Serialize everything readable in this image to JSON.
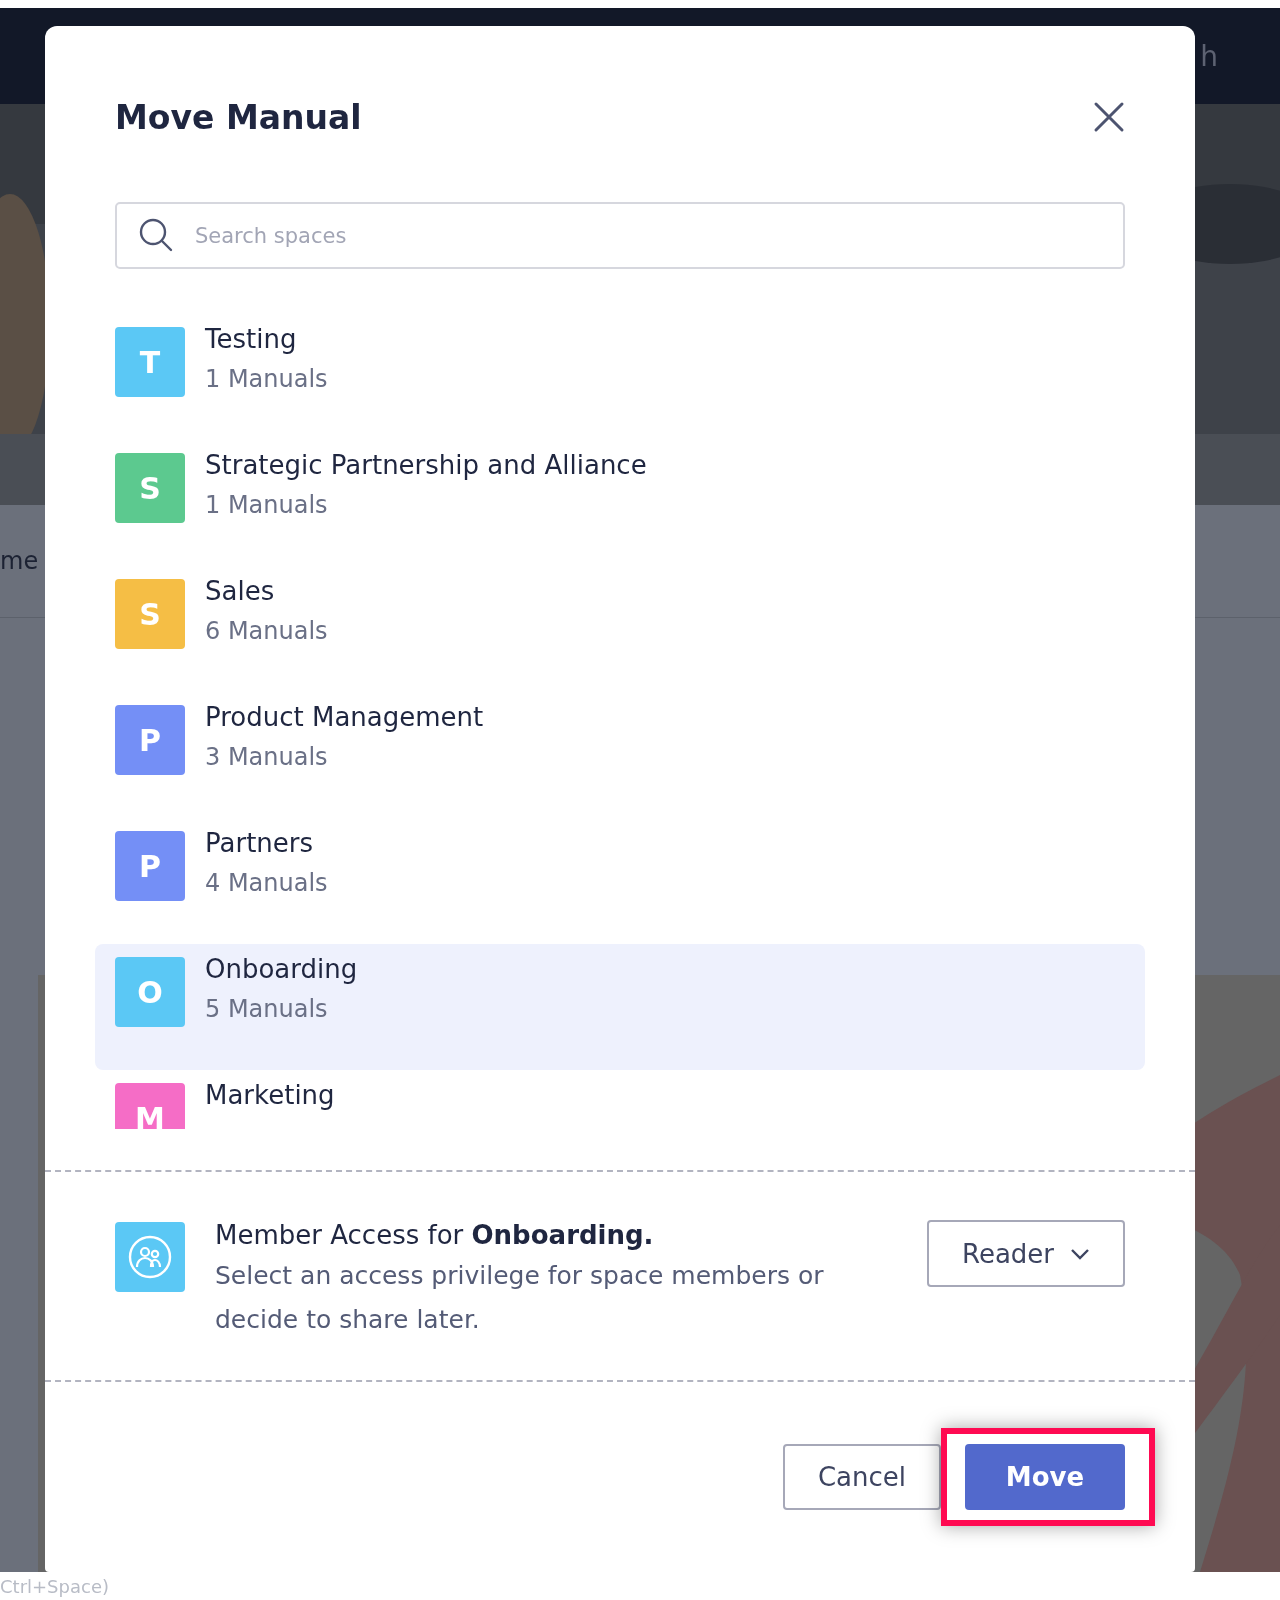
{
  "background": {
    "header_fragment": "h",
    "nav_fragment": "me",
    "footer_fragment": "Ctrl+Space)"
  },
  "dialog": {
    "title": "Move Manual",
    "search": {
      "placeholder": "Search spaces"
    },
    "spaces": [
      {
        "letter": "T",
        "name": "Testing",
        "count": "1 Manuals",
        "color": "#5bc8f5",
        "selected": false
      },
      {
        "letter": "S",
        "name": "Strategic Partnership and Alliance",
        "count": "1 Manuals",
        "color": "#5cc98f",
        "selected": false
      },
      {
        "letter": "S",
        "name": "Sales",
        "count": "6 Manuals",
        "color": "#f5be45",
        "selected": false
      },
      {
        "letter": "P",
        "name": "Product Management",
        "count": "3 Manuals",
        "color": "#748ff6",
        "selected": false
      },
      {
        "letter": "P",
        "name": "Partners",
        "count": "4 Manuals",
        "color": "#748ff6",
        "selected": false
      },
      {
        "letter": "O",
        "name": "Onboarding",
        "count": "5 Manuals",
        "color": "#5bc8f5",
        "selected": true
      },
      {
        "letter": "M",
        "name": "Marketing",
        "color": "#f56dc6",
        "selected": false
      }
    ],
    "access": {
      "heading": "Member Access for **Onboarding.**",
      "description": "Select an access privilege for space members or decide to share later.",
      "role": "Reader"
    },
    "buttons": [
      {
        "label": "Cancel",
        "kind": "secondary",
        "highlighted": false
      },
      {
        "label": "Move",
        "kind": "primary",
        "highlighted": true
      }
    ]
  }
}
